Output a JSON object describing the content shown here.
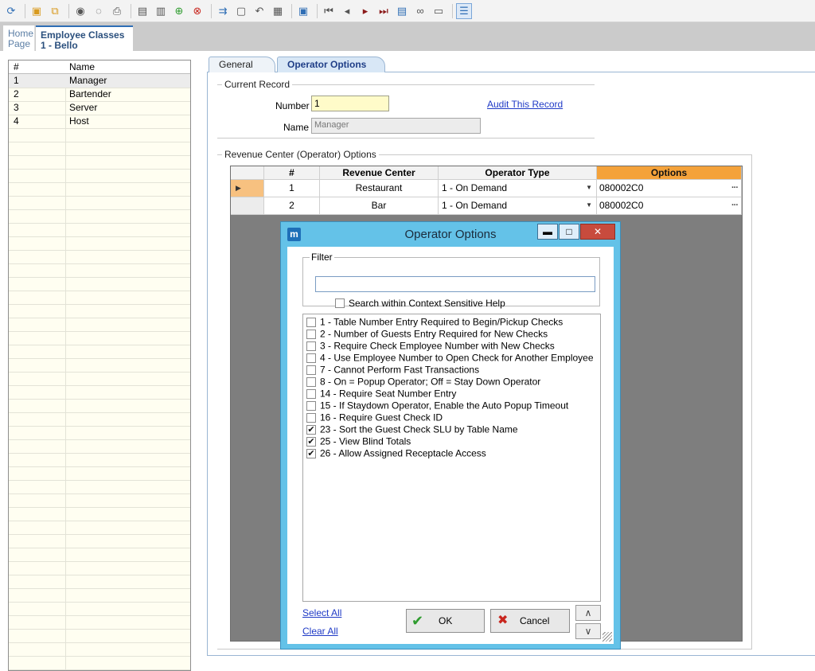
{
  "toolbar": {
    "icons": [
      "refresh-icon",
      "insert-record-icon",
      "insert-copy-icon",
      "find-icon",
      "comment-icon",
      "print-icon",
      "save-icon",
      "save-all-icon",
      "add-icon",
      "delete-icon",
      "copy-records-icon",
      "paste-icon",
      "undo-icon",
      "clipboard-icon",
      "view-icon",
      "first-record-icon",
      "previous-record-icon",
      "next-record-icon",
      "last-record-icon",
      "goto-record-icon",
      "binoculars-icon",
      "window-icon",
      "grid-view-icon"
    ]
  },
  "doc_tabs": {
    "home_line1": "Home",
    "home_line2": "Page",
    "active_line1": "Employee Classes",
    "active_line2": "1 - Bello"
  },
  "left_list": {
    "col_num": "#",
    "col_name": "Name",
    "rows": [
      {
        "num": "1",
        "name": "Manager"
      },
      {
        "num": "2",
        "name": "Bartender"
      },
      {
        "num": "3",
        "name": "Server"
      },
      {
        "num": "4",
        "name": "Host"
      }
    ]
  },
  "tabs": {
    "general": "General",
    "operator_options": "Operator Options"
  },
  "current_record": {
    "title": "Current Record",
    "number_label": "Number",
    "number_value": "1",
    "name_label": "Name",
    "name_placeholder": "Manager",
    "audit_link": "Audit This Record"
  },
  "revenue": {
    "title": "Revenue Center (Operator) Options",
    "headers": {
      "num": "#",
      "rc": "Revenue Center",
      "ot": "Operator Type",
      "opt": "Options"
    },
    "rows": [
      {
        "num": "1",
        "rc": "Restaurant",
        "ot": "1 - On Demand",
        "opt": "080002C0"
      },
      {
        "num": "2",
        "rc": "Bar",
        "ot": "1 - On Demand",
        "opt": "080002C0"
      }
    ]
  },
  "dialog": {
    "logo": "m",
    "title": "Operator Options",
    "filter_title": "Filter",
    "filter_value": "",
    "search_help_label": "Search within Context Sensitive Help",
    "options": [
      {
        "label": "1 - Table Number Entry Required to Begin/Pickup Checks",
        "checked": false
      },
      {
        "label": "2 - Number of Guests Entry Required for New Checks",
        "checked": false
      },
      {
        "label": "3 - Require Check Employee Number with New Checks",
        "checked": false
      },
      {
        "label": "4 - Use Employee Number to Open Check for Another Employee",
        "checked": false
      },
      {
        "label": "7 - Cannot Perform Fast Transactions",
        "checked": false
      },
      {
        "label": "8 - On = Popup Operator; Off = Stay Down Operator",
        "checked": false
      },
      {
        "label": "14 - Require Seat Number Entry",
        "checked": false
      },
      {
        "label": "15 - If Staydown Operator, Enable the Auto Popup Timeout",
        "checked": false
      },
      {
        "label": "16 - Require Guest Check ID",
        "checked": false
      },
      {
        "label": "23 - Sort the Guest Check SLU by Table Name",
        "checked": true
      },
      {
        "label": "25 - View Blind Totals",
        "checked": true
      },
      {
        "label": "26 - Allow Assigned Receptacle Access",
        "checked": true
      }
    ],
    "select_all": "Select All",
    "clear_all": "Clear All",
    "ok": "OK",
    "cancel": "Cancel",
    "up": "∧",
    "down": "∨"
  }
}
